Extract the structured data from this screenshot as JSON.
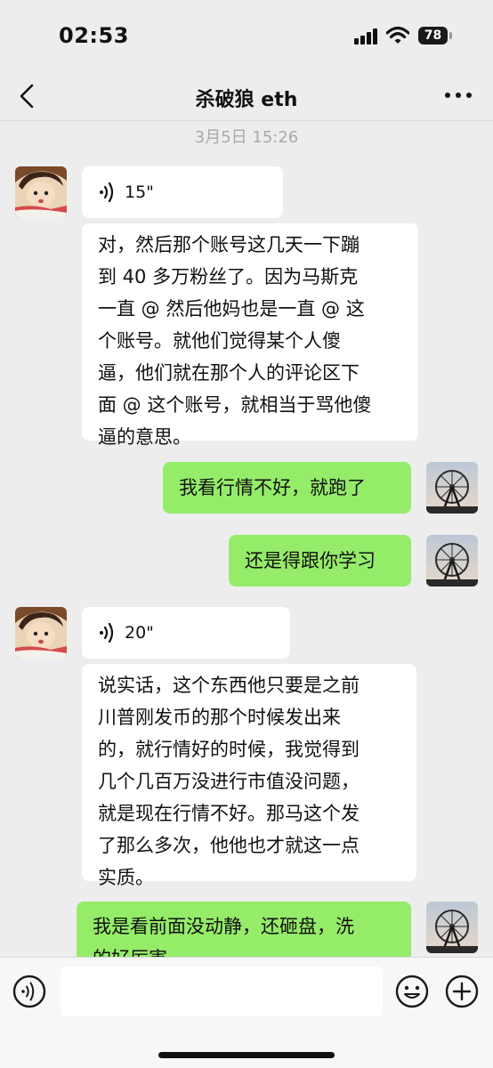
{
  "status_bar": {
    "time": "02:53",
    "battery": "78"
  },
  "nav": {
    "title": "杀破狼 eth"
  },
  "timestamp": "3月5日 15:26",
  "messages": {
    "m1_voice": "15\"",
    "m2_lines": [
      "对，然后那个账号这几天一下蹦",
      "到 40 多万粉丝了。因为马斯克",
      "一直 @ 然后他妈也是一直 @ 这",
      "个账号。就他们觉得某个人傻",
      "逼，他们就在那个人的评论区下",
      "面 @ 这个账号，就相当于骂他傻",
      "逼的意思。"
    ],
    "m3": "我看行情不好，就跑了",
    "m4": "还是得跟你学习",
    "m5_voice": "20\"",
    "m6_lines": [
      "说实话，这个东西他只要是之前",
      "川普刚发币的那个时候发出来",
      "的，就行情好的时候，我觉得到",
      "几个几百万没进行市值没问题，",
      "就是现在行情不好。那马这个发",
      "了那么多次，他他也才就这一点",
      "实质。"
    ],
    "m7_lines": [
      "我是看前面没动静，还砸盘，洗",
      "的好厉害"
    ]
  },
  "icons": {
    "back": "chevron-left-icon",
    "more": "more-dots-icon",
    "voice": "voice-wave-icon",
    "emoji": "smiley-icon",
    "plus": "plus-circle-icon"
  },
  "colors": {
    "outgoing_bubble": "#95ec69",
    "incoming_bubble": "#ffffff",
    "background": "#ededed"
  }
}
